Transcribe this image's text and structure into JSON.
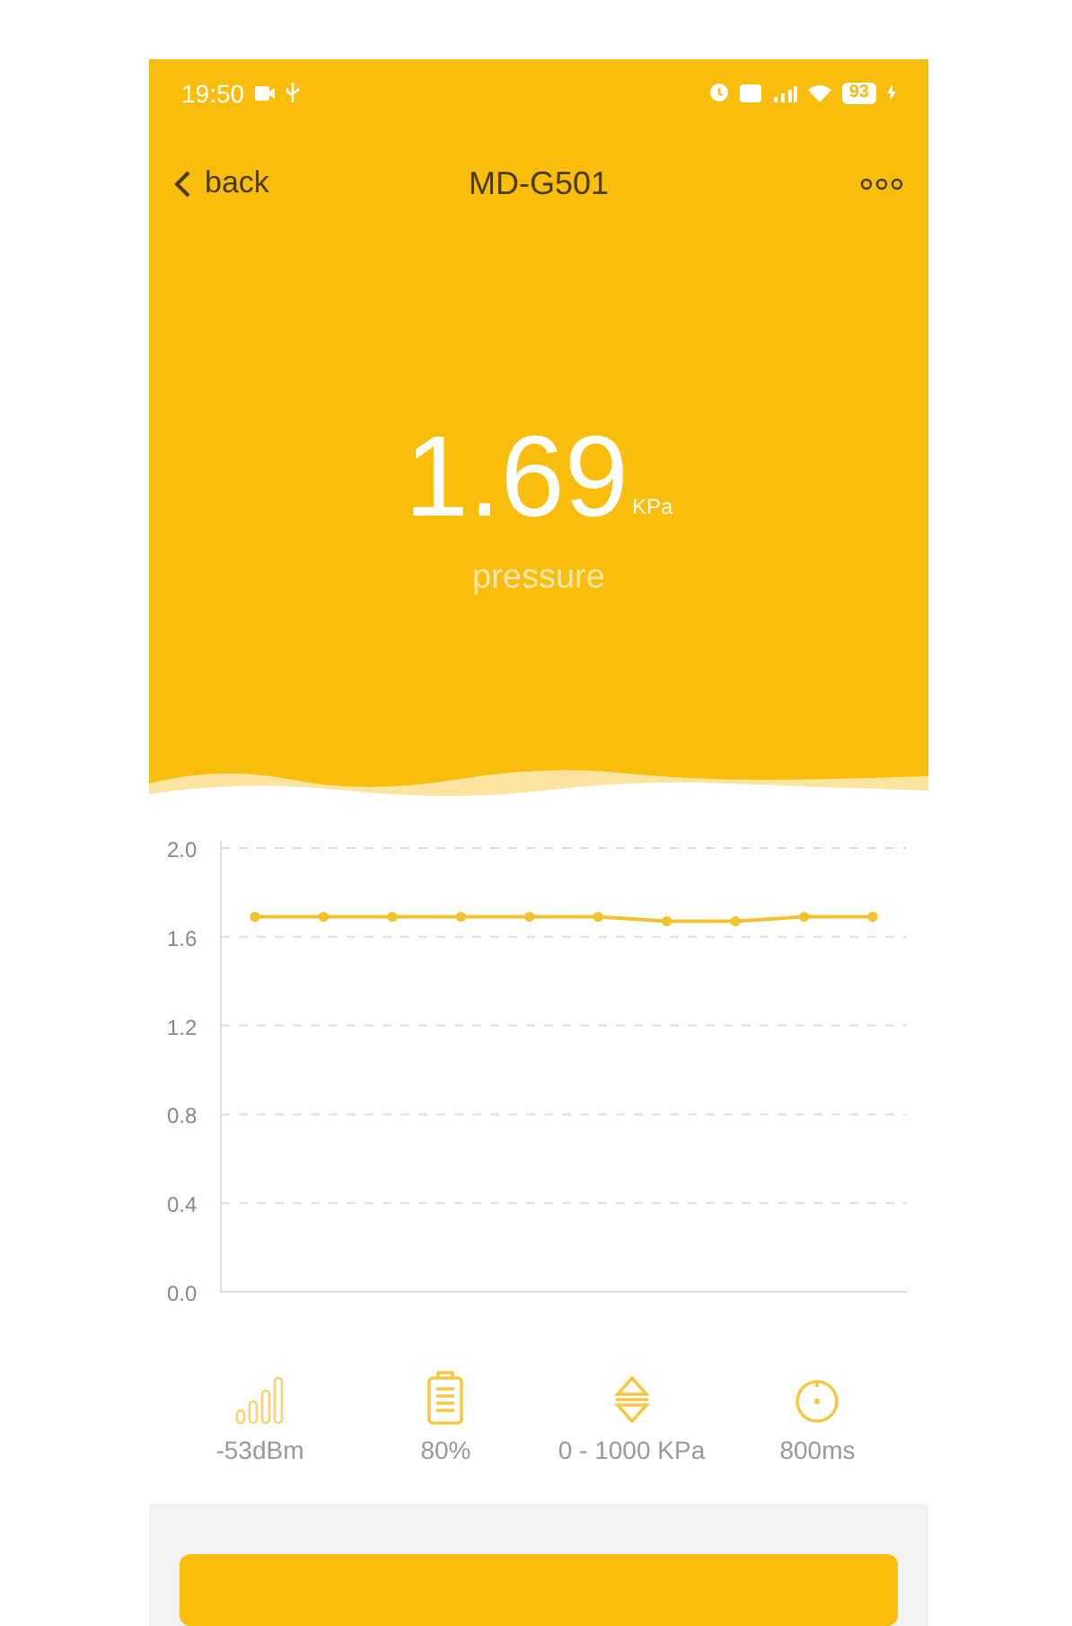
{
  "status_bar": {
    "time": "19:50",
    "battery": "93"
  },
  "nav": {
    "back": "back",
    "title": "MD-G501"
  },
  "reading": {
    "value": "1.69",
    "unit": "KPa",
    "label": "pressure"
  },
  "chart_data": {
    "type": "line",
    "grid": true,
    "ylim": [
      0,
      2
    ],
    "yticks": [
      {
        "value": 0,
        "label": "0.0"
      },
      {
        "value": 0.4,
        "label": "0.4"
      },
      {
        "value": 0.8,
        "label": "0.8"
      },
      {
        "value": 1.2,
        "label": "1.2"
      },
      {
        "value": 1.6,
        "label": "1.6"
      },
      {
        "value": 2,
        "label": "2.0"
      }
    ],
    "series": [
      {
        "color": "#f2c12e",
        "marker": "circle",
        "values": [
          1.69,
          1.69,
          1.69,
          1.69,
          1.69,
          1.69,
          1.67,
          1.67,
          1.69,
          1.69
        ]
      }
    ]
  },
  "stats": [
    {
      "kind": "signal",
      "text": "-53dBm"
    },
    {
      "kind": "battery",
      "text": "80%"
    },
    {
      "kind": "range",
      "text": "0 - 1000 KPa"
    },
    {
      "kind": "interval",
      "text": "800ms"
    }
  ]
}
